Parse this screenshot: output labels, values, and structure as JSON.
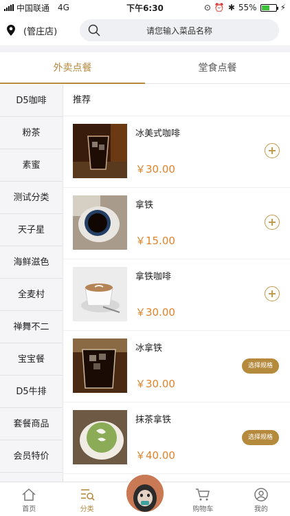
{
  "status": {
    "carrier": "中国联通",
    "network": "4G",
    "time": "下午6:30",
    "battery": "55%",
    "battery_level": 0.55
  },
  "header": {
    "store": "(管庄店)",
    "search_placeholder": "请您输入菜品名称"
  },
  "tabs": [
    {
      "label": "外卖点餐",
      "active": true
    },
    {
      "label": "堂食点餐",
      "active": false
    }
  ],
  "categories": [
    "D5咖啡",
    "粉茶",
    "素蜜",
    "测试分类",
    "天子星",
    "海鲜滋色",
    "全麦村",
    "禅舞不二",
    "宝宝餐",
    "D5牛排",
    "套餐商品",
    "会员特价"
  ],
  "section_title": "推荐",
  "products": [
    {
      "name": "冰美式咖啡",
      "price": "￥30.00",
      "action": "add"
    },
    {
      "name": "拿铁",
      "price": "￥15.00",
      "action": "add"
    },
    {
      "name": "拿铁咖啡",
      "price": "￥30.00",
      "action": "add"
    },
    {
      "name": "冰拿铁",
      "price": "￥30.00",
      "action": "spec",
      "action_label": "选择规格"
    },
    {
      "name": "抹茶拿铁",
      "price": "￥40.00",
      "action": "spec",
      "action_label": "选择规格"
    }
  ],
  "nav": [
    {
      "label": "首页",
      "icon": "home-icon"
    },
    {
      "label": "分类",
      "icon": "category-icon",
      "active": true
    },
    {
      "label": "购物车",
      "icon": "cart-icon"
    },
    {
      "label": "我的",
      "icon": "user-icon"
    }
  ],
  "colors": {
    "accent": "#b58a3d",
    "price": "#e0842a"
  }
}
